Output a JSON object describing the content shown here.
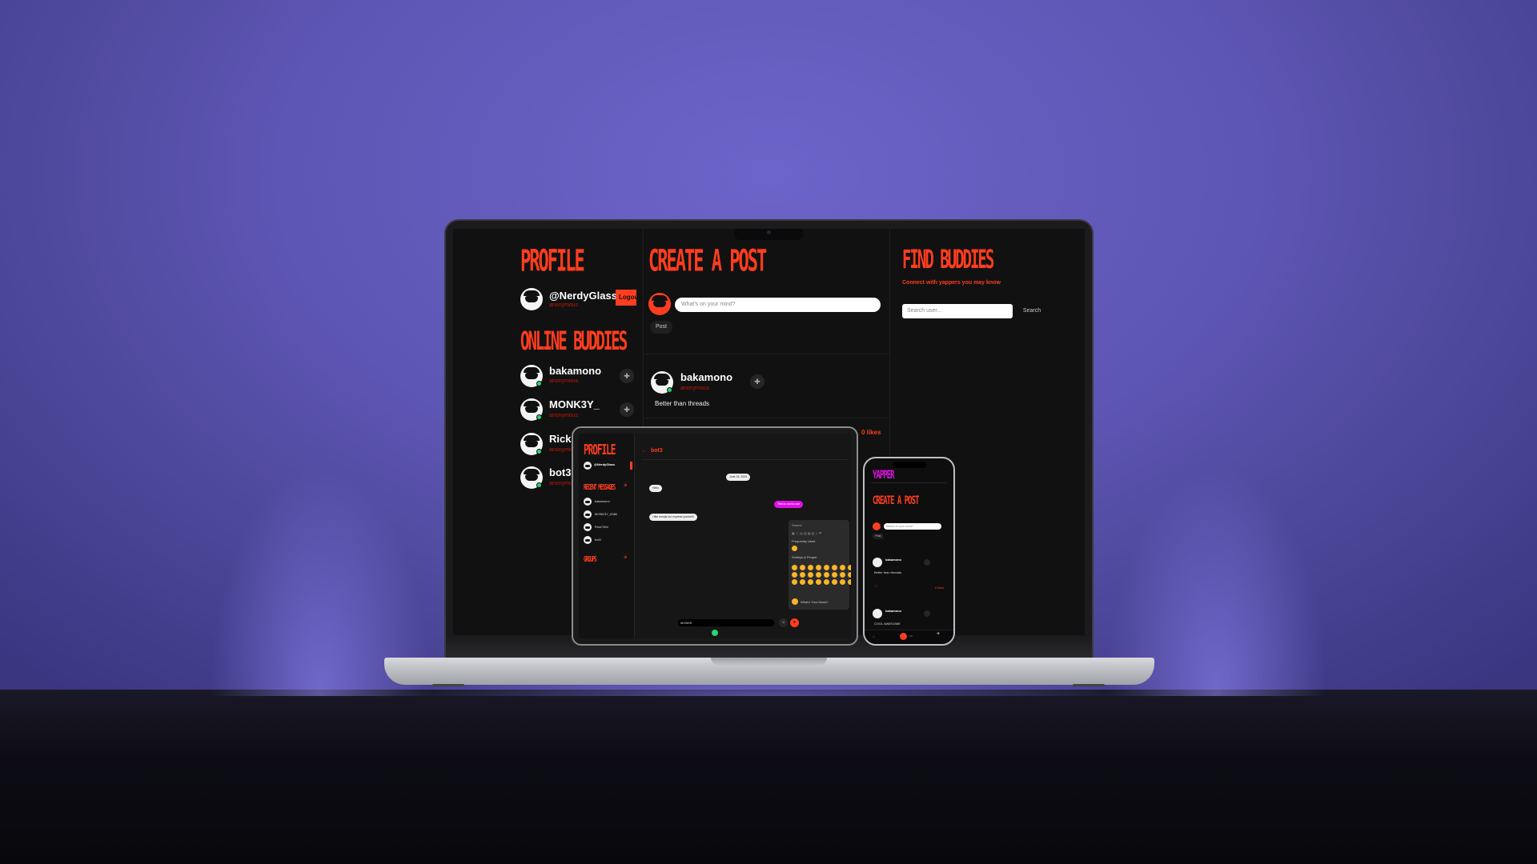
{
  "desktop": {
    "profile": {
      "heading": "PROFILE",
      "username": "@NerdyGlass",
      "subtitle": "anonymous",
      "logout_label": "Logout"
    },
    "online_buddies": {
      "heading": "ONLINE BUDDIES",
      "items": [
        {
          "name": "bakamono",
          "subtitle": "anonymous"
        },
        {
          "name": "MONK3Y_",
          "subtitle": "anonymous"
        },
        {
          "name": "Rick7",
          "subtitle": "anonymous"
        },
        {
          "name": "bot3",
          "subtitle": "anonymous"
        }
      ]
    },
    "create_post": {
      "heading": "CREATE A POST",
      "placeholder": "What's on your mind?",
      "post_button": "Post"
    },
    "feed": {
      "posts": [
        {
          "author": "bakamono",
          "subtitle": "anonymous",
          "text": "Better than threads",
          "likes": "0 likes"
        }
      ]
    },
    "find_buddies": {
      "heading": "FIND BUDDIES",
      "subtitle": "Connect with yappers you may know",
      "search_placeholder": "Search user...",
      "search_button": "Search"
    }
  },
  "tablet": {
    "profile_heading": "PROFILE",
    "username": "@NerdyGlass",
    "recent_heading": "RECENT MESSAGES",
    "groups_heading": "GROUPS",
    "contacts": [
      "bakamono",
      "MONK3Y_6380",
      "Rick7264",
      "bot3"
    ],
    "chat_title": "bot3",
    "date_chip": "June 16, 2024",
    "messages": [
      {
        "from": "them",
        "text": "Hello"
      },
      {
        "from": "me",
        "text": "This is cool to use"
      },
      {
        "from": "them",
        "text": "I like emojis too express yourself!"
      }
    ],
    "emoji_search": "Search",
    "emoji_frequent": "Frequently Used",
    "emoji_section": "Smileys & People",
    "emoji_footer": "What's Your Mood?",
    "input_value": "MONKE"
  },
  "phone": {
    "brand": "YAPPER",
    "heading": "CREATE A POST",
    "placeholder": "What's on your mind?",
    "post_button": "Post",
    "posts": [
      {
        "author": "bakamono",
        "text": "Better than threads",
        "likes": "0 likes"
      },
      {
        "author": "bakamono",
        "text": "COOL AWESOME"
      }
    ]
  },
  "colors": {
    "accent": "#ff3d1f",
    "pink": "#e010e8",
    "online": "#2ad36b",
    "background": "#111111"
  }
}
